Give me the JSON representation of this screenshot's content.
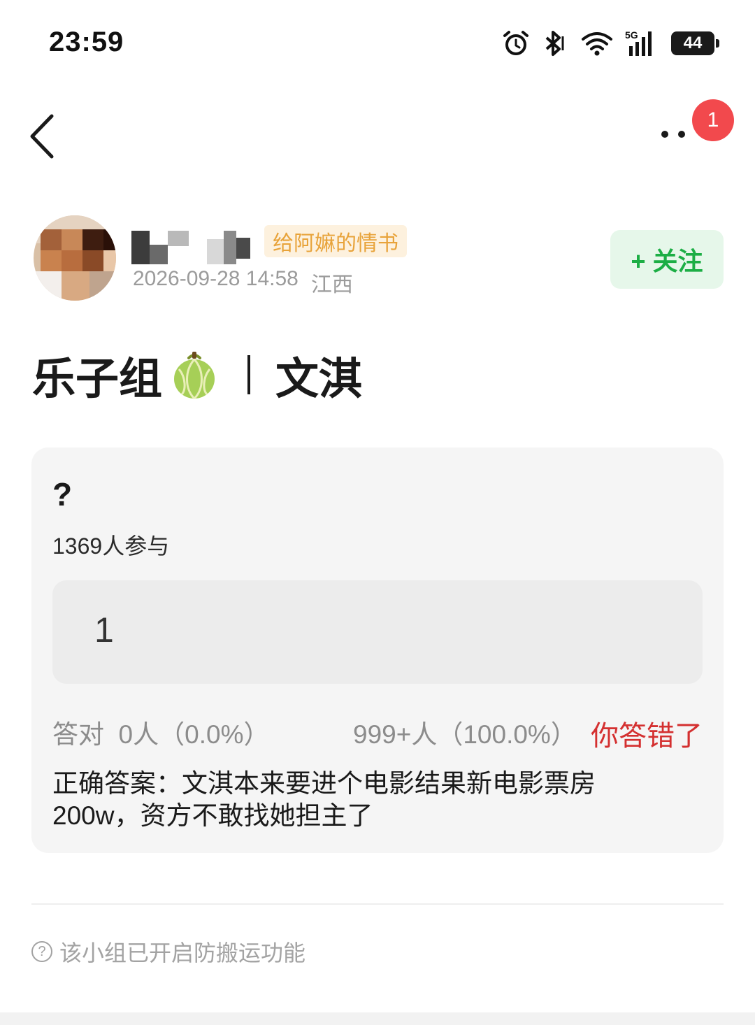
{
  "status_bar": {
    "time": "23:59",
    "network": "5G",
    "battery": "44",
    "icons": [
      "alarm-icon",
      "bluetooth-icon",
      "wifi-icon",
      "signal-icon",
      "battery-icon"
    ]
  },
  "nav": {
    "back_icon": "chevron-left-icon",
    "more_icon": "more-icon",
    "badge_count": "1"
  },
  "author": {
    "tag": "给阿嫲的情书",
    "date": "2026-09-28 14:58",
    "location": "江西",
    "follow_label": "+ 关注"
  },
  "post": {
    "title_left": "乐子组",
    "title_emoji": "melon-icon",
    "title_right": "文淇"
  },
  "quiz": {
    "question": "?",
    "participants": "1369人参与",
    "option": "1",
    "correct_stat": "答对  0人（0.0%）",
    "wrong_stat": "999+人（100.0%）",
    "result": "你答错了",
    "answer": "正确答案：文淇本来要进个电影结果新电影票房200w，资方不敢找她担主了"
  },
  "notice": {
    "icon": "question-circle-icon",
    "text": "该小组已开启防搬运功能"
  },
  "colors": {
    "follow_green": "#1cae45",
    "tag_orange": "#e8a33a",
    "badge_red": "#f2494d",
    "wrong_red": "#d43030"
  }
}
